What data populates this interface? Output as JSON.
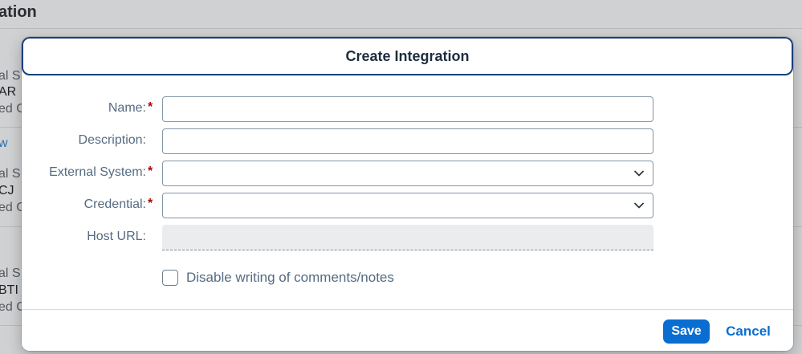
{
  "background": {
    "title": "ation",
    "cards": [
      {
        "line1": "al S",
        "line2": "AR",
        "line3": "ed C"
      },
      {
        "line1": "al S",
        "line2": "CJ",
        "line3": "ed C"
      },
      {
        "line1": "al S",
        "line2": "BTI",
        "line3": "ed C"
      }
    ],
    "link_text": "w"
  },
  "dialog": {
    "title": "Create Integration",
    "fields": {
      "name": {
        "label": "Name:",
        "required": "*",
        "value": ""
      },
      "description": {
        "label": "Description:",
        "value": ""
      },
      "external_system": {
        "label": "External System:",
        "required": "*",
        "value": ""
      },
      "credential": {
        "label": "Credential:",
        "required": "*",
        "value": ""
      },
      "host_url": {
        "label": "Host URL:",
        "value": ""
      }
    },
    "checkbox": {
      "label": "Disable writing of comments/notes",
      "checked": false
    },
    "footer": {
      "save_label": "Save",
      "cancel_label": "Cancel"
    }
  },
  "colors": {
    "accent": "#0a6ed1",
    "header_border": "#1a3f80",
    "required": "#aa0808",
    "label": "#556b82"
  },
  "icons": {
    "select_chevron": "chevron-down-icon"
  }
}
